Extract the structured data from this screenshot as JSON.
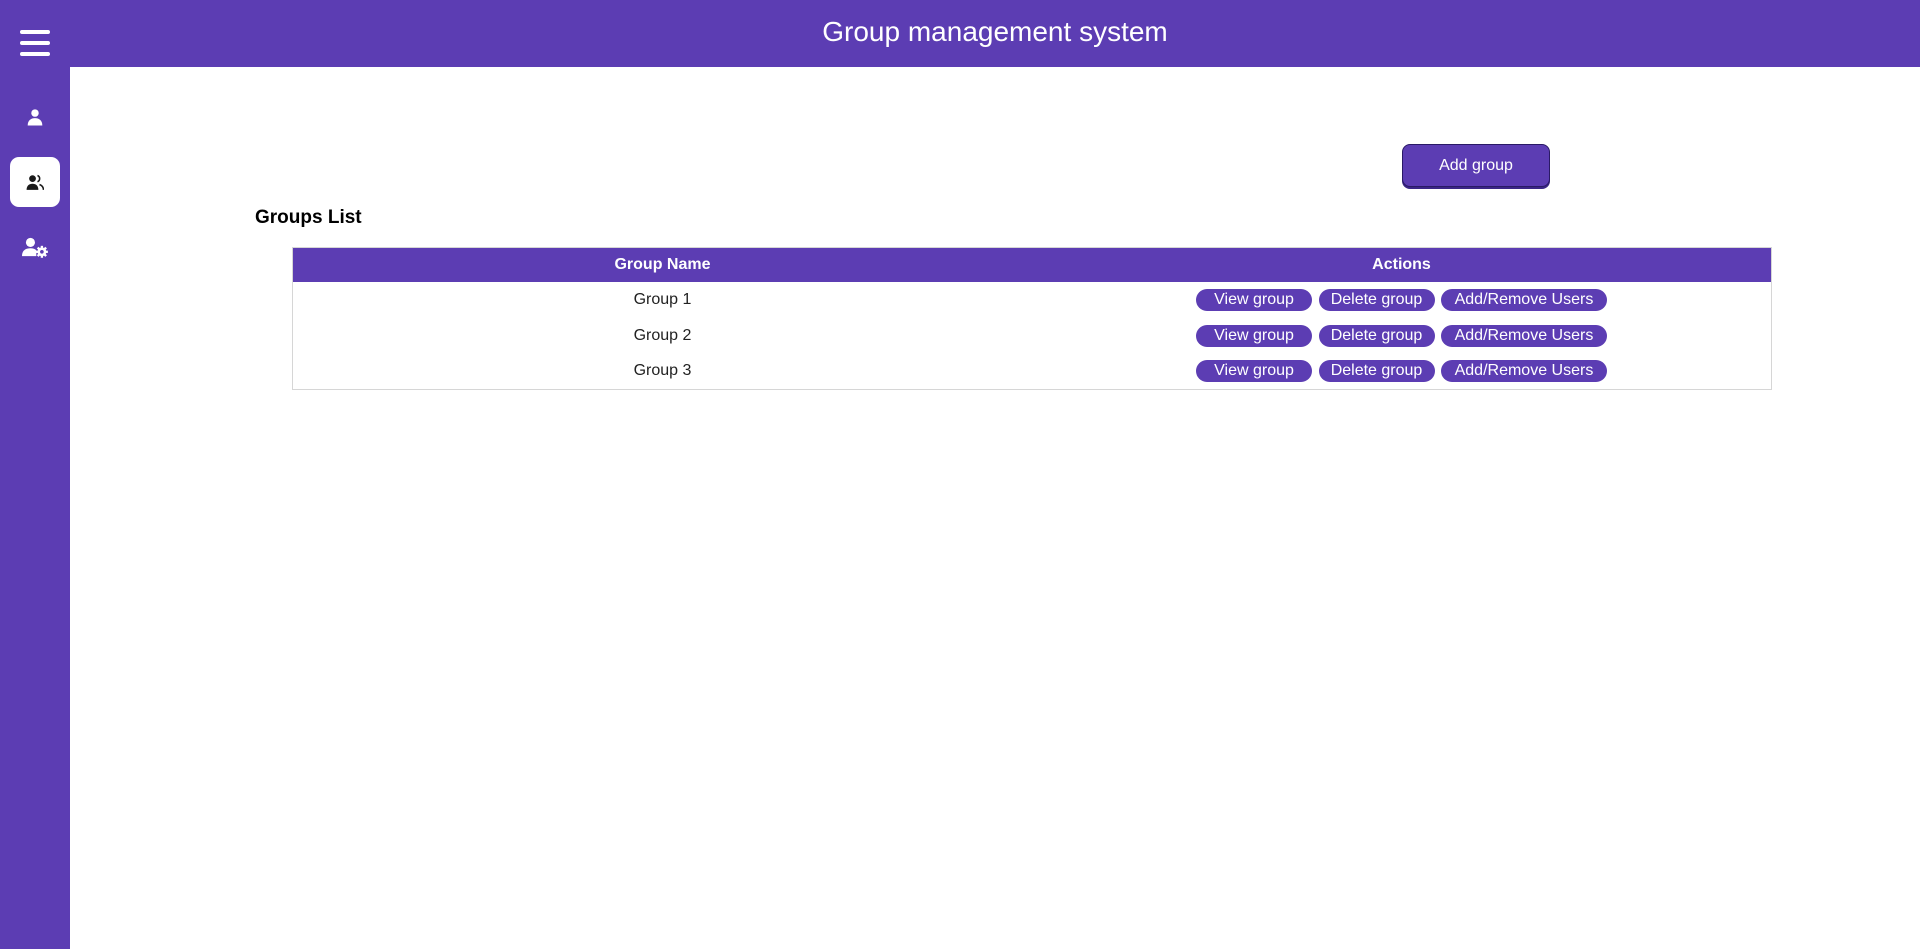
{
  "header": {
    "title": "Group management system"
  },
  "sidebar": {
    "menu_icon": "hamburger-menu-icon",
    "items": [
      {
        "icon": "user-icon",
        "active": false
      },
      {
        "icon": "users-icon",
        "active": true
      },
      {
        "icon": "user-gear-icon",
        "active": false
      }
    ]
  },
  "main": {
    "add_group_label": "Add group",
    "section_title": "Groups List",
    "table": {
      "columns": [
        "Group Name",
        "Actions"
      ],
      "rows": [
        {
          "name": "Group 1",
          "view": "View group",
          "delete": "Delete group",
          "addremove": "Add/Remove Users"
        },
        {
          "name": "Group 2",
          "view": "View group",
          "delete": "Delete group",
          "addremove": "Add/Remove Users"
        },
        {
          "name": "Group 3",
          "view": "View group",
          "delete": "Delete group",
          "addremove": "Add/Remove Users"
        }
      ]
    }
  },
  "colors": {
    "accent": "#5c3db3",
    "background": "#ffffff",
    "text": "#222222"
  }
}
